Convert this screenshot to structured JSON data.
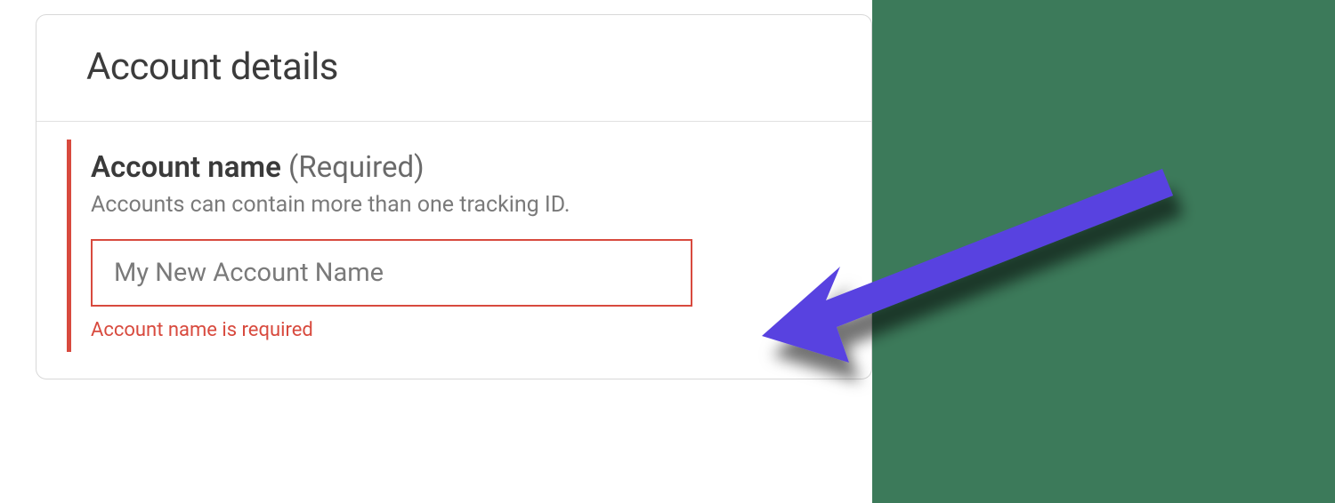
{
  "card": {
    "title": "Account details",
    "field": {
      "label": "Account name",
      "required_text": "(Required)",
      "hint": "Accounts can contain more than one tracking ID.",
      "placeholder": "My New Account Name",
      "error": "Account name is required"
    }
  },
  "colors": {
    "error": "#d84a3e",
    "arrow": "#5843e0",
    "sidebar": "#3c7a5a"
  }
}
